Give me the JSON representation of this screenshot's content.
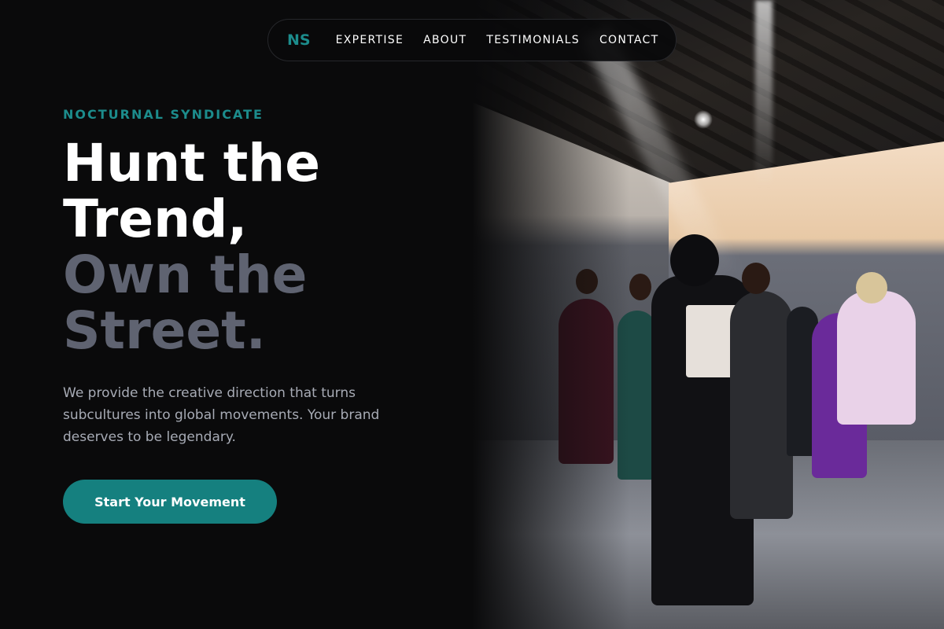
{
  "nav": {
    "logo": "NS",
    "links": [
      "EXPERTISE",
      "ABOUT",
      "TESTIMONIALS",
      "CONTACT"
    ]
  },
  "hero": {
    "eyebrow": "NOCTURNAL SYNDICATE",
    "headline_lines": [
      "Hunt the",
      "Trend,",
      "Own the",
      "Street."
    ],
    "description": "We provide the creative direction that turns subcultures into global movements. Your brand deserves to be legendary.",
    "cta_label": "Start Your Movement"
  },
  "colors": {
    "background": "#0a0a0b",
    "accent": "#1c8c8c",
    "headline_muted": "#5f6371",
    "body_text": "#a7abb5"
  },
  "images": {
    "hero_photo": "fashion-show-backstage-photo"
  }
}
